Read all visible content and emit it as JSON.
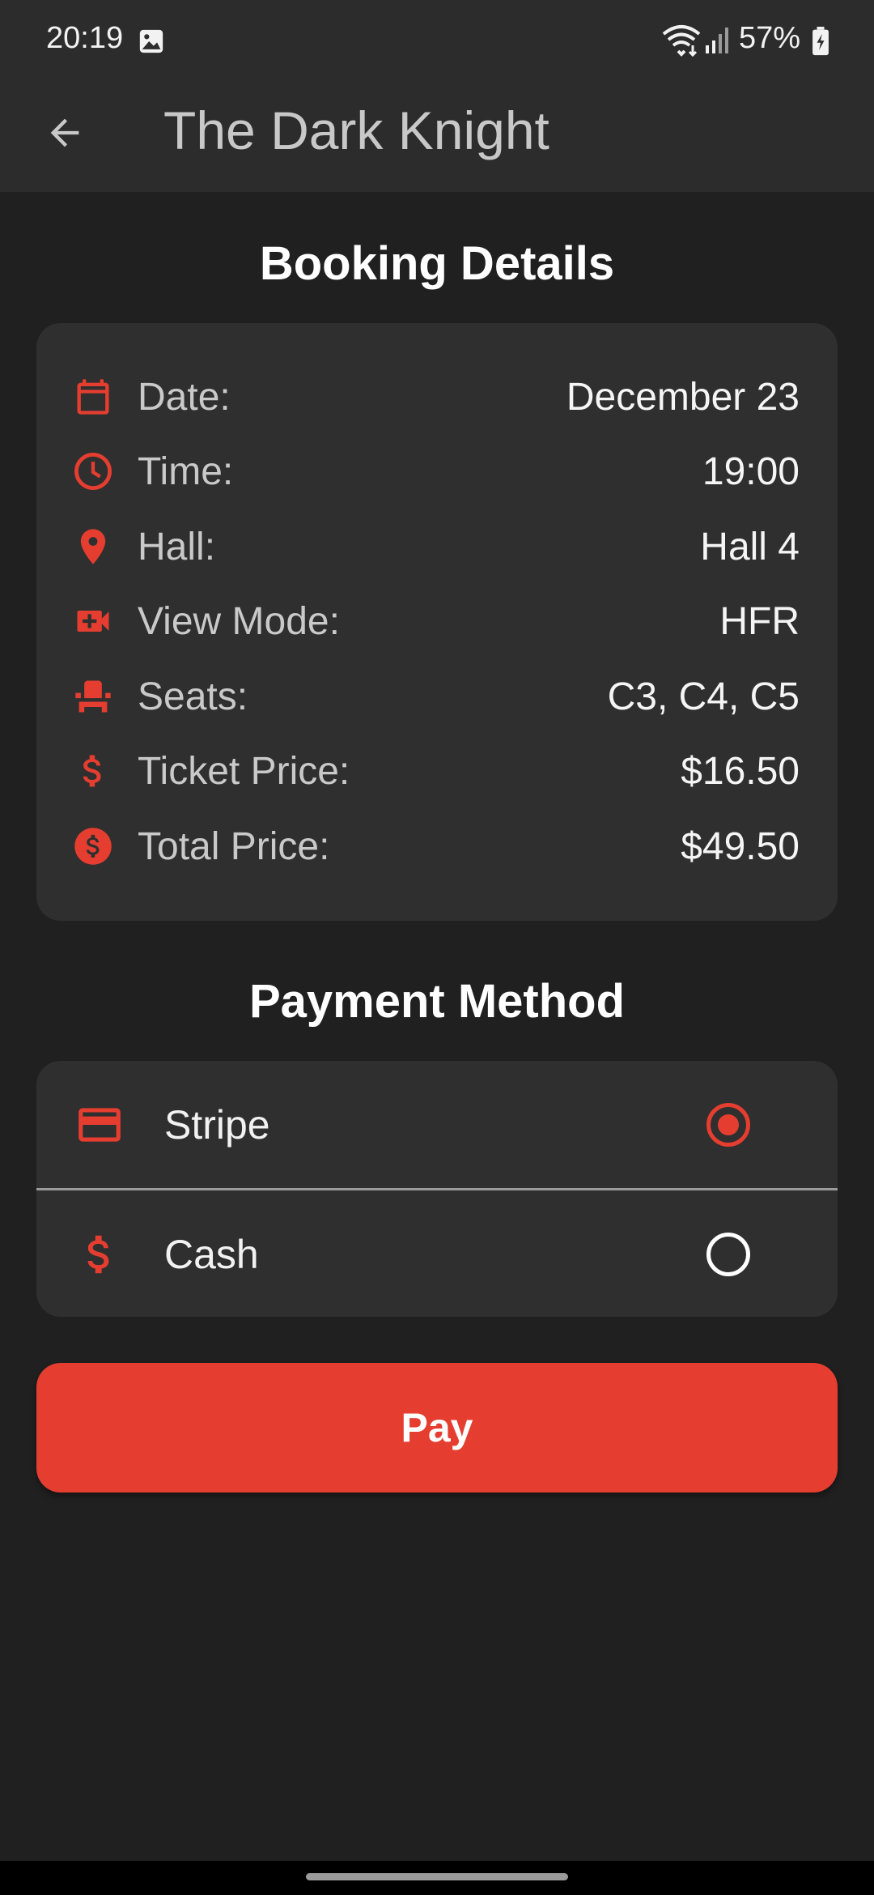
{
  "status_bar": {
    "time": "20:19",
    "battery": "57%",
    "icons": [
      "gallery-icon",
      "wifi-icon",
      "signal-icon",
      "battery-charging-icon"
    ]
  },
  "app_bar": {
    "title": "The Dark Knight",
    "back_icon": "arrow-back-icon"
  },
  "booking": {
    "title": "Booking Details",
    "rows": [
      {
        "icon": "calendar-icon",
        "label": "Date:",
        "value": "December 23"
      },
      {
        "icon": "clock-icon",
        "label": "Time:",
        "value": "19:00"
      },
      {
        "icon": "location-pin-icon",
        "label": "Hall:",
        "value": "Hall 4"
      },
      {
        "icon": "video-camera-icon",
        "label": "View Mode:",
        "value": "HFR"
      },
      {
        "icon": "seat-icon",
        "label": "Seats:",
        "value": "C3, C4, C5"
      },
      {
        "icon": "dollar-icon",
        "label": "Ticket Price:",
        "value": "$16.50"
      },
      {
        "icon": "dollar-circle-icon",
        "label": "Total Price:",
        "value": "$49.50"
      }
    ]
  },
  "payment": {
    "title": "Payment Method",
    "options": [
      {
        "icon": "credit-card-icon",
        "label": "Stripe",
        "selected": true
      },
      {
        "icon": "dollar-icon",
        "label": "Cash",
        "selected": false
      }
    ]
  },
  "pay_button": {
    "label": "Pay"
  },
  "colors": {
    "accent": "#e53e30",
    "background": "#202020",
    "card": "#2f2f2f",
    "app_bar": "#2c2c2c"
  }
}
